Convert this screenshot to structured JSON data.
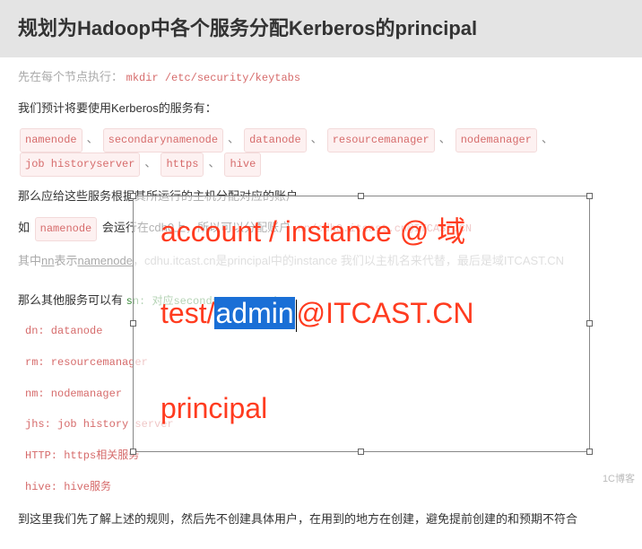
{
  "header": {
    "title": "规划为Hadoop中各个服务分配Kerberos的principal"
  },
  "line_mkdir_pre": "先在每个节点执行：",
  "mkdir_cmd": "mkdir /etc/security/keytabs",
  "line_services_intro": "我们预计将要使用Kerberos的服务有：",
  "services": [
    "namenode",
    "secondarynamenode",
    "datanode",
    "resourcemanager",
    "nodemanager",
    "job historyserver",
    "https",
    "hive"
  ],
  "line_assign": "那么应给这些服务根据其所运行的主机分配对应的账户",
  "line_eg_pre": "如",
  "line_eg_svc": "namenode",
  "line_eg_mid": "会运行在cdh0上，所以可以分配账户",
  "line_eg_acct": "nn/cdh0.itcast.cn@ITCAST.CN",
  "line_explain": "其中nn表示namenode，cdhu.itcast.cn是principal中的instance 我们以主机名来代替，最后是域ITCAST.CN",
  "line_other": "那么其他服务可以有",
  "sn_text": "sn: 对应secondarynamenode",
  "mappings": [
    {
      "k": "dn",
      "v": "datanode"
    },
    {
      "k": "rm",
      "v": "resourcemanager"
    },
    {
      "k": "nm",
      "v": "nodemanager"
    },
    {
      "k": "jhs",
      "v": "job history server"
    },
    {
      "k": "HTTP",
      "v": "https相关服务"
    },
    {
      "k": "hive",
      "v": "hive服务"
    }
  ],
  "line_bottom": "到这里我们先了解上述的规则，然后先不创建具体用户，在用到的地方在创建，避免提前创建的和预期不符合",
  "overlay": {
    "line1": "account / instance @ 域",
    "line2_pre": "test/",
    "line2_sel": "admin",
    "line2_post": "@ITCAST.CN",
    "line3": "principal"
  },
  "watermark": "1C博客"
}
